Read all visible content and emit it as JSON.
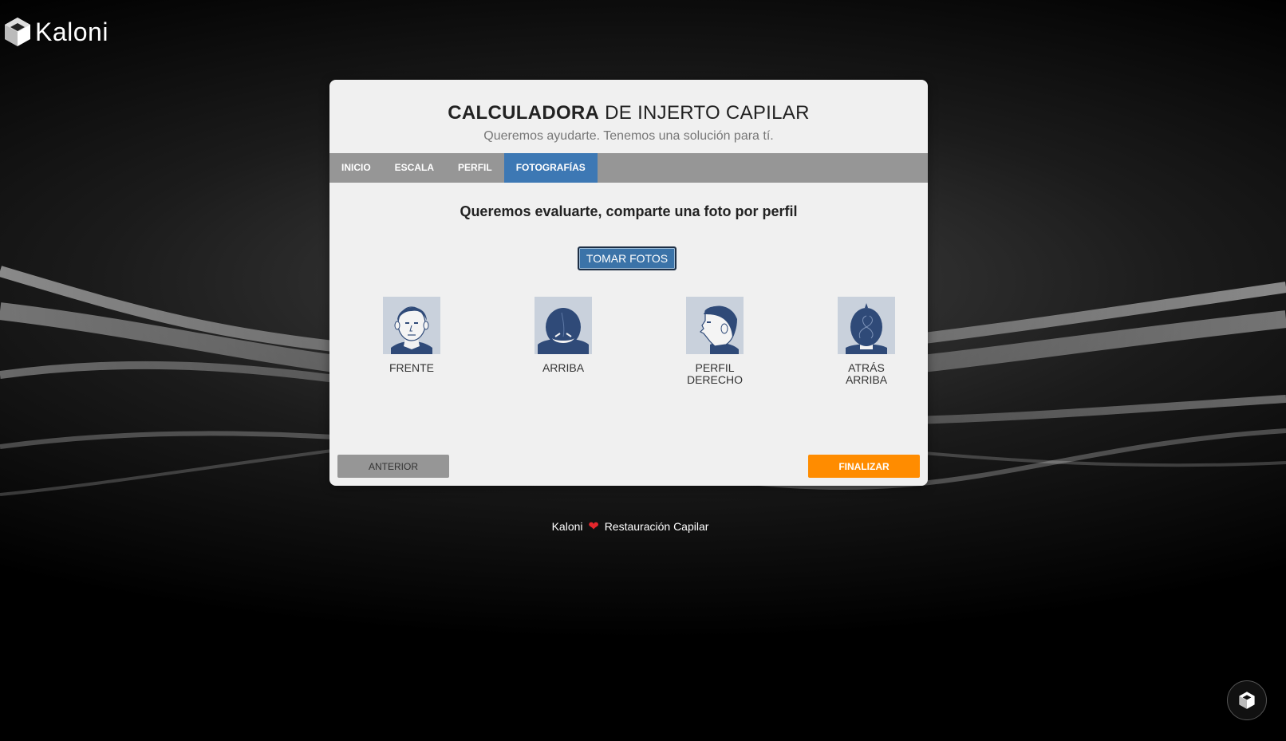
{
  "brand": {
    "name": "Kaloni",
    "icon": "kaloni-cube-logo"
  },
  "card": {
    "title_bold": "CALCULADORA",
    "title_rest": " DE INJERTO CAPILAR",
    "subtitle": "Queremos ayudarte. Tenemos una solución para tí."
  },
  "tabs": [
    {
      "label": "INICIO",
      "active": false
    },
    {
      "label": "ESCALA",
      "active": false
    },
    {
      "label": "PERFIL",
      "active": false
    },
    {
      "label": "FOTOGRAFÍAS",
      "active": true
    }
  ],
  "main": {
    "prompt": "Queremos evaluarte, comparte una foto por perfil",
    "take_photos_label": "TOMAR FOTOS"
  },
  "photos": [
    {
      "label_line1": "FRENTE",
      "label_line2": "",
      "icon": "head-front-icon"
    },
    {
      "label_line1": "ARRIBA",
      "label_line2": "",
      "icon": "head-top-icon"
    },
    {
      "label_line1": "PERFIL",
      "label_line2": "DERECHO",
      "icon": "head-profile-right-icon"
    },
    {
      "label_line1": "ATRÁS",
      "label_line2": "ARRIBA",
      "icon": "head-back-top-icon"
    }
  ],
  "nav": {
    "prev_label": "ANTERIOR",
    "finish_label": "FINALIZAR"
  },
  "footer": {
    "left": "Kaloni",
    "heart": "❤",
    "right": "Restauración Capilar"
  },
  "colors": {
    "active_tab": "#3d78b4",
    "finish": "#ff8c00",
    "tabs_bar": "#969696",
    "illustration": "#2f4a78"
  }
}
